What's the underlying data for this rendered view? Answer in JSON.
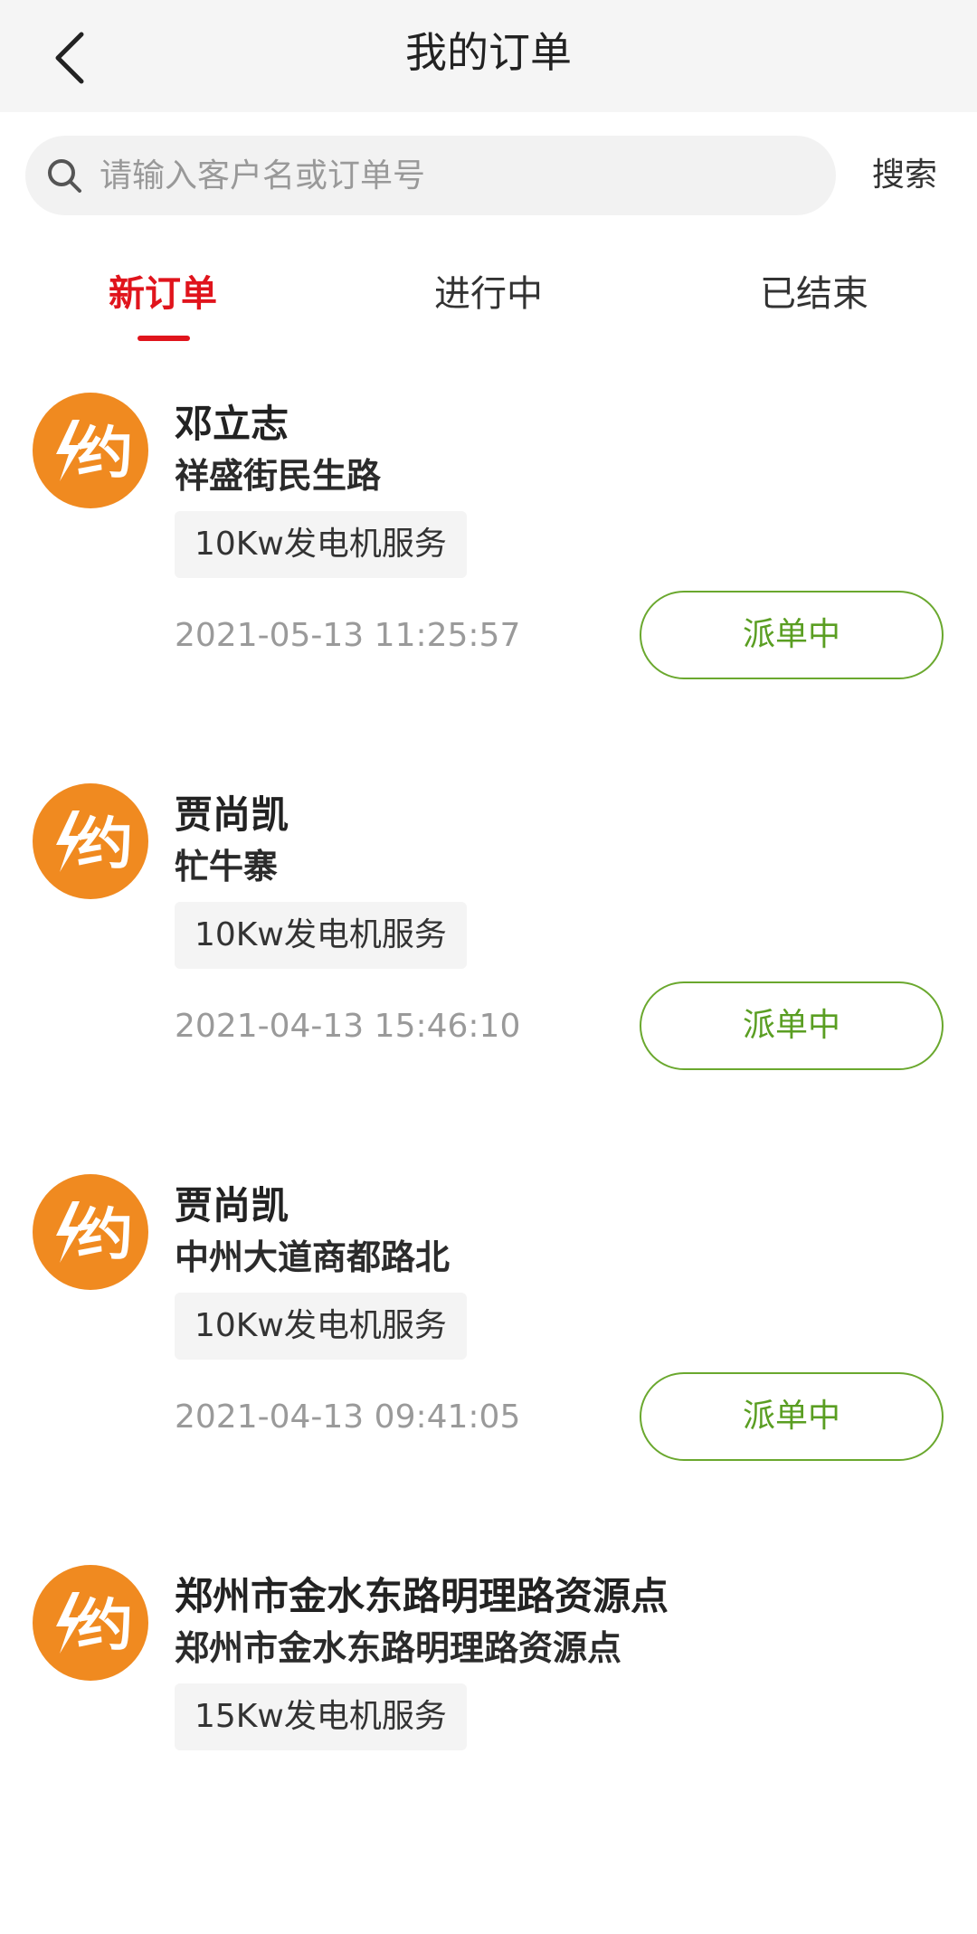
{
  "header": {
    "title": "我的订单",
    "back_icon": "chevron-left-icon"
  },
  "search": {
    "placeholder": "请输入客户名或订单号",
    "value": "",
    "button_label": "搜索",
    "icon": "search-icon"
  },
  "tabs": [
    {
      "label": "新订单",
      "active": true
    },
    {
      "label": "进行中",
      "active": false
    },
    {
      "label": "已结束",
      "active": false
    }
  ],
  "colors": {
    "accent": "#e0141c",
    "avatar": "#f08a20",
    "status": "#5a9e22"
  },
  "avatar_glyph": "约",
  "orders": [
    {
      "name": "邓立志",
      "address": "祥盛街民生路",
      "service": "10Kw发电机服务",
      "time": "2021-05-13 11:25:57",
      "status": "派单中"
    },
    {
      "name": "贾尚凯",
      "address": "牤牛寨",
      "service": "10Kw发电机服务",
      "time": "2021-04-13 15:46:10",
      "status": "派单中"
    },
    {
      "name": "贾尚凯",
      "address": "中州大道商都路北",
      "service": "10Kw发电机服务",
      "time": "2021-04-13 09:41:05",
      "status": "派单中"
    },
    {
      "name": "郑州市金水东路明理路资源点",
      "address": "郑州市金水东路明理路资源点",
      "service": "15Kw发电机服务"
    }
  ]
}
